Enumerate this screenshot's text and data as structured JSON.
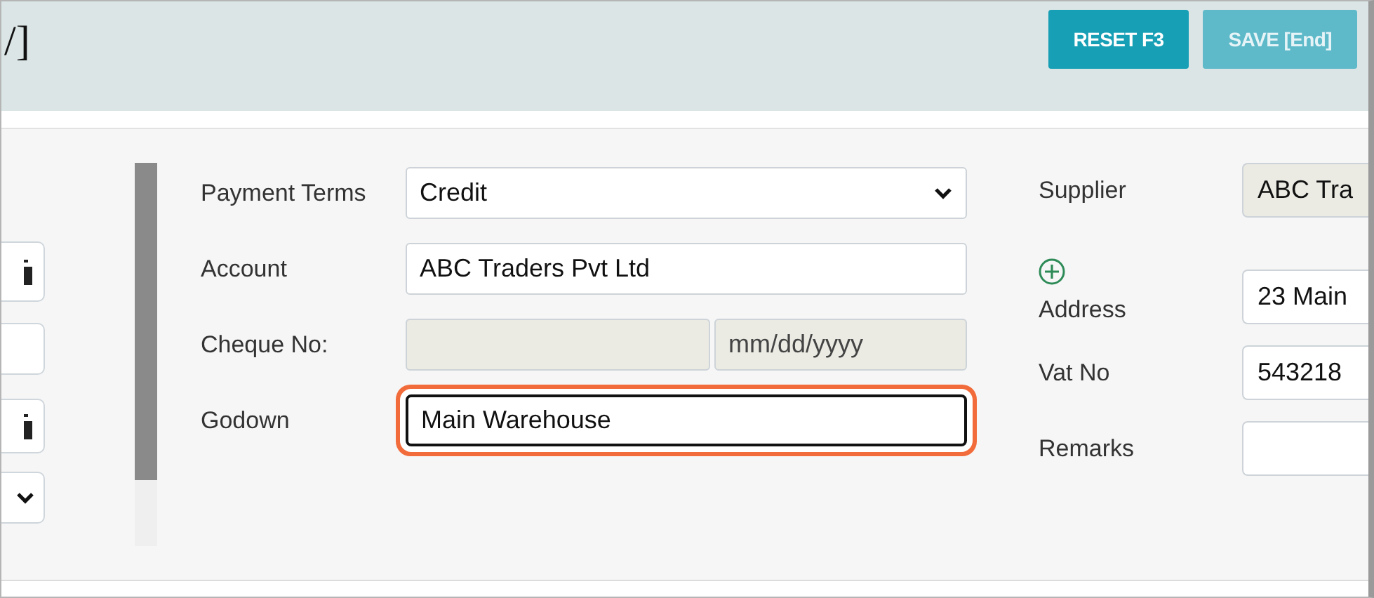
{
  "header": {
    "title": "/]",
    "buttons": [
      {
        "label": "RESET F3",
        "disabled": false
      },
      {
        "label": "SAVE [End]",
        "disabled": true
      }
    ]
  },
  "form": {
    "rows": [
      {
        "kind": "select",
        "label": "Payment Terms",
        "value": "Credit",
        "disabled": false,
        "focused": false
      },
      {
        "kind": "text",
        "label": "Account",
        "value": "ABC Traders Pvt Ltd",
        "disabled": false,
        "focused": false
      },
      {
        "kind": "cheque",
        "label": "Cheque No:",
        "date_placeholder": "mm/dd/yyyy",
        "disabled": true,
        "focused": false
      },
      {
        "kind": "text",
        "label": "Godown",
        "value": "Main Warehouse",
        "disabled": false,
        "focused": true
      }
    ]
  },
  "supplier": {
    "rows": [
      {
        "label": "Supplier",
        "value": "ABC Tra",
        "disabled": true,
        "add_button": false
      },
      {
        "label": "Address",
        "value": "23 Main",
        "disabled": false,
        "add_button": true
      },
      {
        "label": "Vat No",
        "value": "543218",
        "disabled": false,
        "add_button": false
      },
      {
        "label": "Remarks",
        "disabled": false,
        "add_button": false
      }
    ]
  }
}
